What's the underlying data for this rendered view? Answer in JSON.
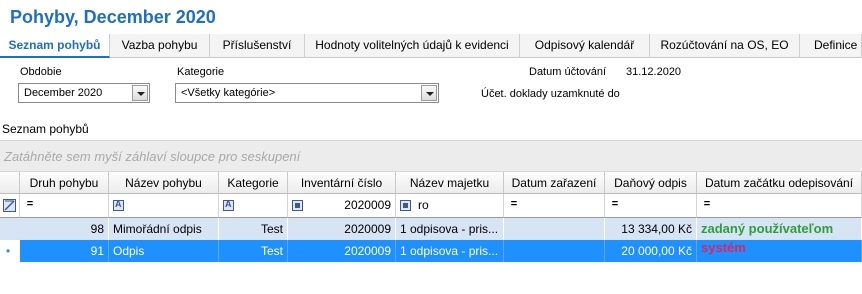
{
  "title": "Pohyby, December 2020",
  "tabs": [
    "Seznam pohybů",
    "Vazba pohybu",
    "Příslušenství",
    "Hodnoty volitelných údajů k evidenci",
    "Odpisový kalendář",
    "Rozúčtování na OS, EO",
    "Definice UD"
  ],
  "filters": {
    "period_label": "Obdobie",
    "period_value": "December 2020",
    "category_label": "Kategorie",
    "category_value": "<Všetky kategórie>",
    "accounting_date_label": "Datum účtování",
    "accounting_date_value": "31.12.2020",
    "locked_docs_label": "Účet. doklady uzamknuté do"
  },
  "section_title": "Seznam pohybů",
  "group_hint": "Zatáhněte sem myší záhlaví sloupce pro seskupení",
  "columns": [
    "Druh pohybu",
    "Název pohybu",
    "Kategorie",
    "Inventární číslo",
    "Název majetku",
    "Datum zařazení",
    "Daňový odpis",
    "Datum začátku odepisování"
  ],
  "filter_row": {
    "op": "=",
    "inventory_value": "2020009",
    "asset_value": "ro"
  },
  "rows": [
    {
      "type": "98",
      "name": "Mimořádní odpis",
      "category": "Test",
      "inventory": "2020009",
      "asset": "1 odpisova - pris...",
      "placed": "",
      "tax": "13 334,00 Kč",
      "start": "zadaný používateľom"
    },
    {
      "type": "91",
      "name": "Odpis",
      "category": "Test",
      "inventory": "2020009",
      "asset": "1 odpisova - pris...",
      "placed": "",
      "tax": "20 000,00 Kč",
      "start": "systém"
    }
  ],
  "colors": {
    "accent": "#1d6fc7",
    "selected_row": "#1e90ff",
    "highlight_row": "#d7e4f4",
    "note_user": "#2e9e3a",
    "note_system": "#e0245e"
  },
  "icons": {
    "combo_arrow": "chevron-down-icon",
    "filter_row_indicator": "filter-clear-icon",
    "current_row_indicator": "bullet-icon"
  }
}
